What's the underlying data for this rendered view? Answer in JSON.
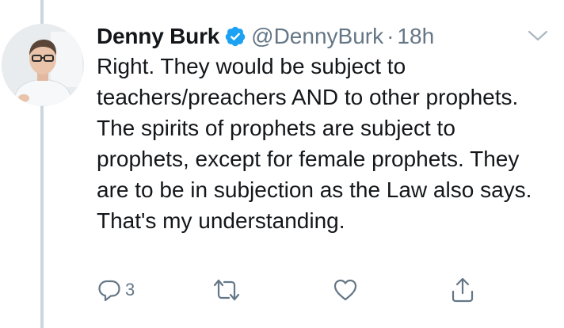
{
  "tweet": {
    "author_name": "Denny Burk",
    "handle": "@DennyBurk",
    "separator": "·",
    "timestamp": "18h",
    "verified": true,
    "text": "Right. They would be subject to teachers/preachers AND to other prophets. The spirits of prophets are subject to prophets, except for female prophets. They are to be in subjection as the Law also says. That's my understanding.",
    "reply_count": "3"
  },
  "icons": {
    "verified": "verified-badge-icon",
    "caret": "chevron-down-icon",
    "reply": "reply-icon",
    "retweet": "retweet-icon",
    "like": "heart-icon",
    "share": "share-icon"
  },
  "colors": {
    "accent": "#1da1f2",
    "text": "#14171a",
    "secondary": "#657786",
    "thread_line": "#ccd6dd"
  }
}
